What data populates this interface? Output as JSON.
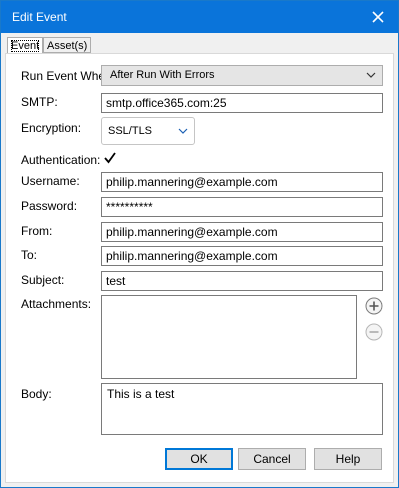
{
  "window": {
    "title": "Edit Event"
  },
  "tabs": [
    {
      "label": "Event"
    },
    {
      "label": "Asset(s)"
    }
  ],
  "form": {
    "run_when": {
      "label": "Run Event When:",
      "value": "After Run With Errors"
    },
    "smtp": {
      "label": "SMTP:",
      "value": "smtp.office365.com:25"
    },
    "encryption": {
      "label": "Encryption:",
      "value": "SSL/TLS"
    },
    "authentication": {
      "label": "Authentication:",
      "checked": true
    },
    "username": {
      "label": "Username:",
      "value": "philip.mannering@example.com"
    },
    "password": {
      "label": "Password:",
      "value": "**********"
    },
    "from": {
      "label": "From:",
      "value": "philip.mannering@example.com"
    },
    "to": {
      "label": "To:",
      "value": "philip.mannering@example.com"
    },
    "subject": {
      "label": "Subject:",
      "value": "test"
    },
    "attachments": {
      "label": "Attachments:"
    },
    "body": {
      "label": "Body:",
      "value": "This is a test"
    }
  },
  "buttons": {
    "ok": "OK",
    "cancel": "Cancel",
    "help": "Help"
  },
  "icons": {
    "close": "close-icon",
    "add_attachment": "plus-circle-icon",
    "remove_attachment": "minus-circle-icon"
  },
  "colors": {
    "titlebar": "#0a74da",
    "default_button_border": "#0078d7"
  }
}
